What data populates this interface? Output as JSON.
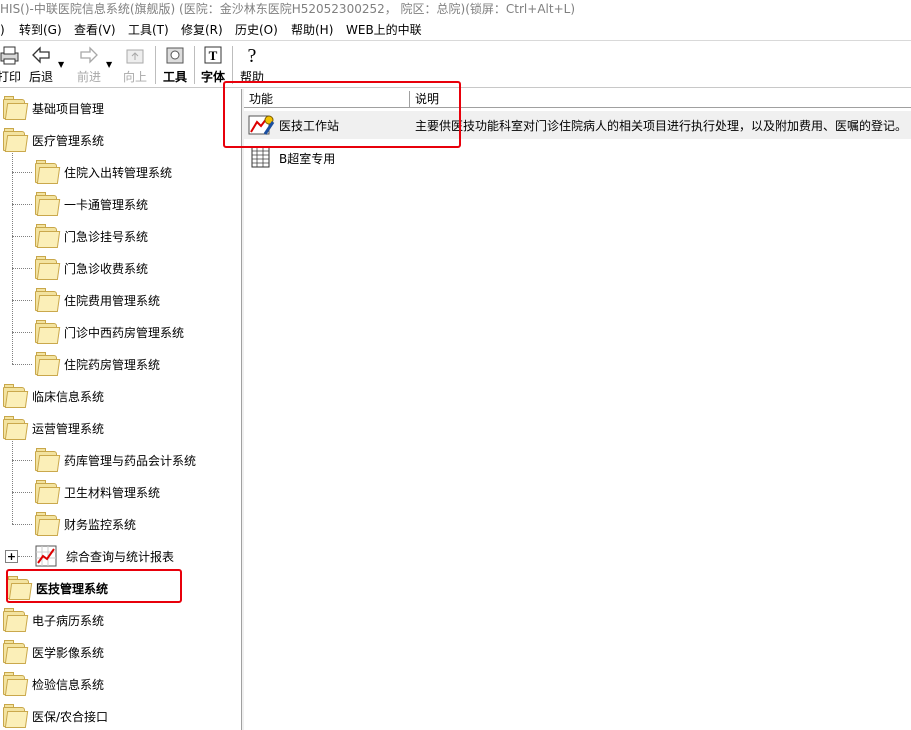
{
  "window": {
    "title": "HIS()-中联医院信息系统(旗舰版) (医院：金沙林东医院H52052300252， 院区：总院)(锁屏：Ctrl+Alt+L)"
  },
  "menubar": {
    "items": [
      {
        "label": ")"
      },
      {
        "label": "转到(G)"
      },
      {
        "label": "查看(V)"
      },
      {
        "label": "工具(T)"
      },
      {
        "label": "修复(R)"
      },
      {
        "label": "历史(O)"
      },
      {
        "label": "帮助(H)"
      },
      {
        "label": "WEB上的中联"
      }
    ]
  },
  "toolbar": {
    "print": "打印",
    "back": "后退",
    "forward": "前进",
    "up": "向上",
    "tools": "工具",
    "font": "字体",
    "help": "帮助"
  },
  "tree": {
    "nodes": [
      {
        "label": "基础项目管理"
      },
      {
        "label": "医疗管理系统"
      },
      {
        "label": "住院入出转管理系统"
      },
      {
        "label": "一卡通管理系统"
      },
      {
        "label": "门急诊挂号系统"
      },
      {
        "label": "门急诊收费系统"
      },
      {
        "label": "住院费用管理系统"
      },
      {
        "label": "门诊中西药房管理系统"
      },
      {
        "label": "住院药房管理系统"
      },
      {
        "label": "临床信息系统"
      },
      {
        "label": "运营管理系统"
      },
      {
        "label": "药库管理与药品会计系统"
      },
      {
        "label": "卫生材料管理系统"
      },
      {
        "label": "财务监控系统"
      },
      {
        "label": "综合查询与统计报表"
      },
      {
        "label": "医技管理系统"
      },
      {
        "label": "电子病历系统"
      },
      {
        "label": "医学影像系统"
      },
      {
        "label": "检验信息系统"
      },
      {
        "label": "医保/农合接口"
      }
    ]
  },
  "list": {
    "columns": [
      "功能",
      "说明"
    ],
    "rows": [
      {
        "name": "医技工作站",
        "desc": "主要供医技功能科室对门诊住院病人的相关项目进行执行处理，以及附加费用、医嘱的登记。"
      },
      {
        "name": "B超室专用",
        "desc": ""
      }
    ]
  },
  "colors": {
    "highlight": "#e8000b",
    "folder": "#f3e3a0"
  }
}
